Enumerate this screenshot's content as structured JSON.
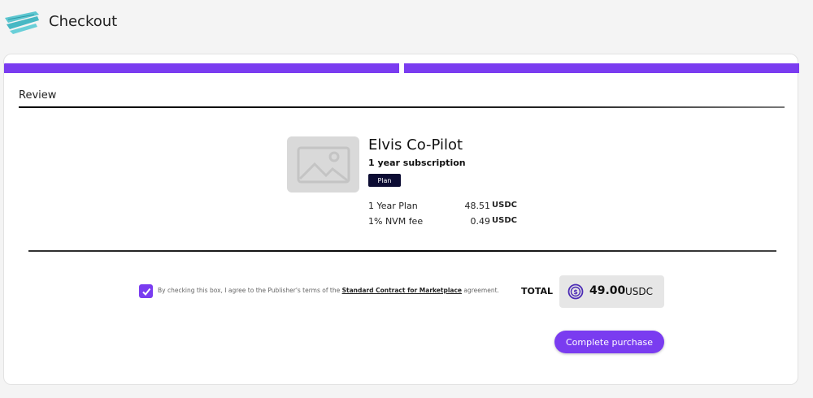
{
  "header": {
    "title": "Checkout",
    "logo_icon": "teal-brush-logo-icon"
  },
  "steps": {
    "count": 2,
    "active_color": "#7a3cf0"
  },
  "review": {
    "label": "Review"
  },
  "product": {
    "image_icon": "image-placeholder-icon",
    "name": "Elvis Co-Pilot",
    "subscription": "1 year subscription",
    "badge": "Plan",
    "lines": [
      {
        "label": "1 Year Plan",
        "amount": "48.51",
        "currency": "USDC"
      },
      {
        "label": "1% NVM fee",
        "amount": "0.49",
        "currency": "USDC"
      }
    ]
  },
  "agreement": {
    "checked": true,
    "text_before": "By checking this box, I agree to the Publisher's terms of the",
    "link_text": "Standard Contract for Marketplace",
    "text_after": "agreement."
  },
  "total": {
    "label": "TOTAL",
    "icon": "usdc-coin-icon",
    "amount": "49.00",
    "currency": "USDC"
  },
  "actions": {
    "purchase_label": "Complete purchase"
  },
  "colors": {
    "accent": "#7a3cf0",
    "badge_bg": "#0c0c33",
    "total_bg": "#e6e6e6"
  }
}
